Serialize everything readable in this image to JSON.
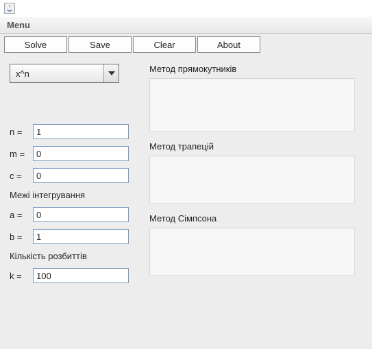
{
  "menubar": {
    "menu_label": "Menu"
  },
  "toolbar": {
    "solve_label": "Solve",
    "save_label": "Save",
    "clear_label": "Clear",
    "about_label": "About"
  },
  "function_combo": {
    "selected": "x^n"
  },
  "params": {
    "n_label": "n =",
    "n_value": "1",
    "m_label": "m =",
    "m_value": "0",
    "c_label": "c =",
    "c_value": "0"
  },
  "bounds": {
    "heading": "Межі інтегрування",
    "a_label": "a =",
    "a_value": "0",
    "b_label": "b =",
    "b_value": "1"
  },
  "partitions": {
    "heading": "Кількість розбиттів",
    "k_label": "k =",
    "k_value": "100"
  },
  "results": {
    "rect_title": "Метод прямокутників",
    "trap_title": "Метод трапецій",
    "simp_title": "Метод Сімпсона"
  }
}
